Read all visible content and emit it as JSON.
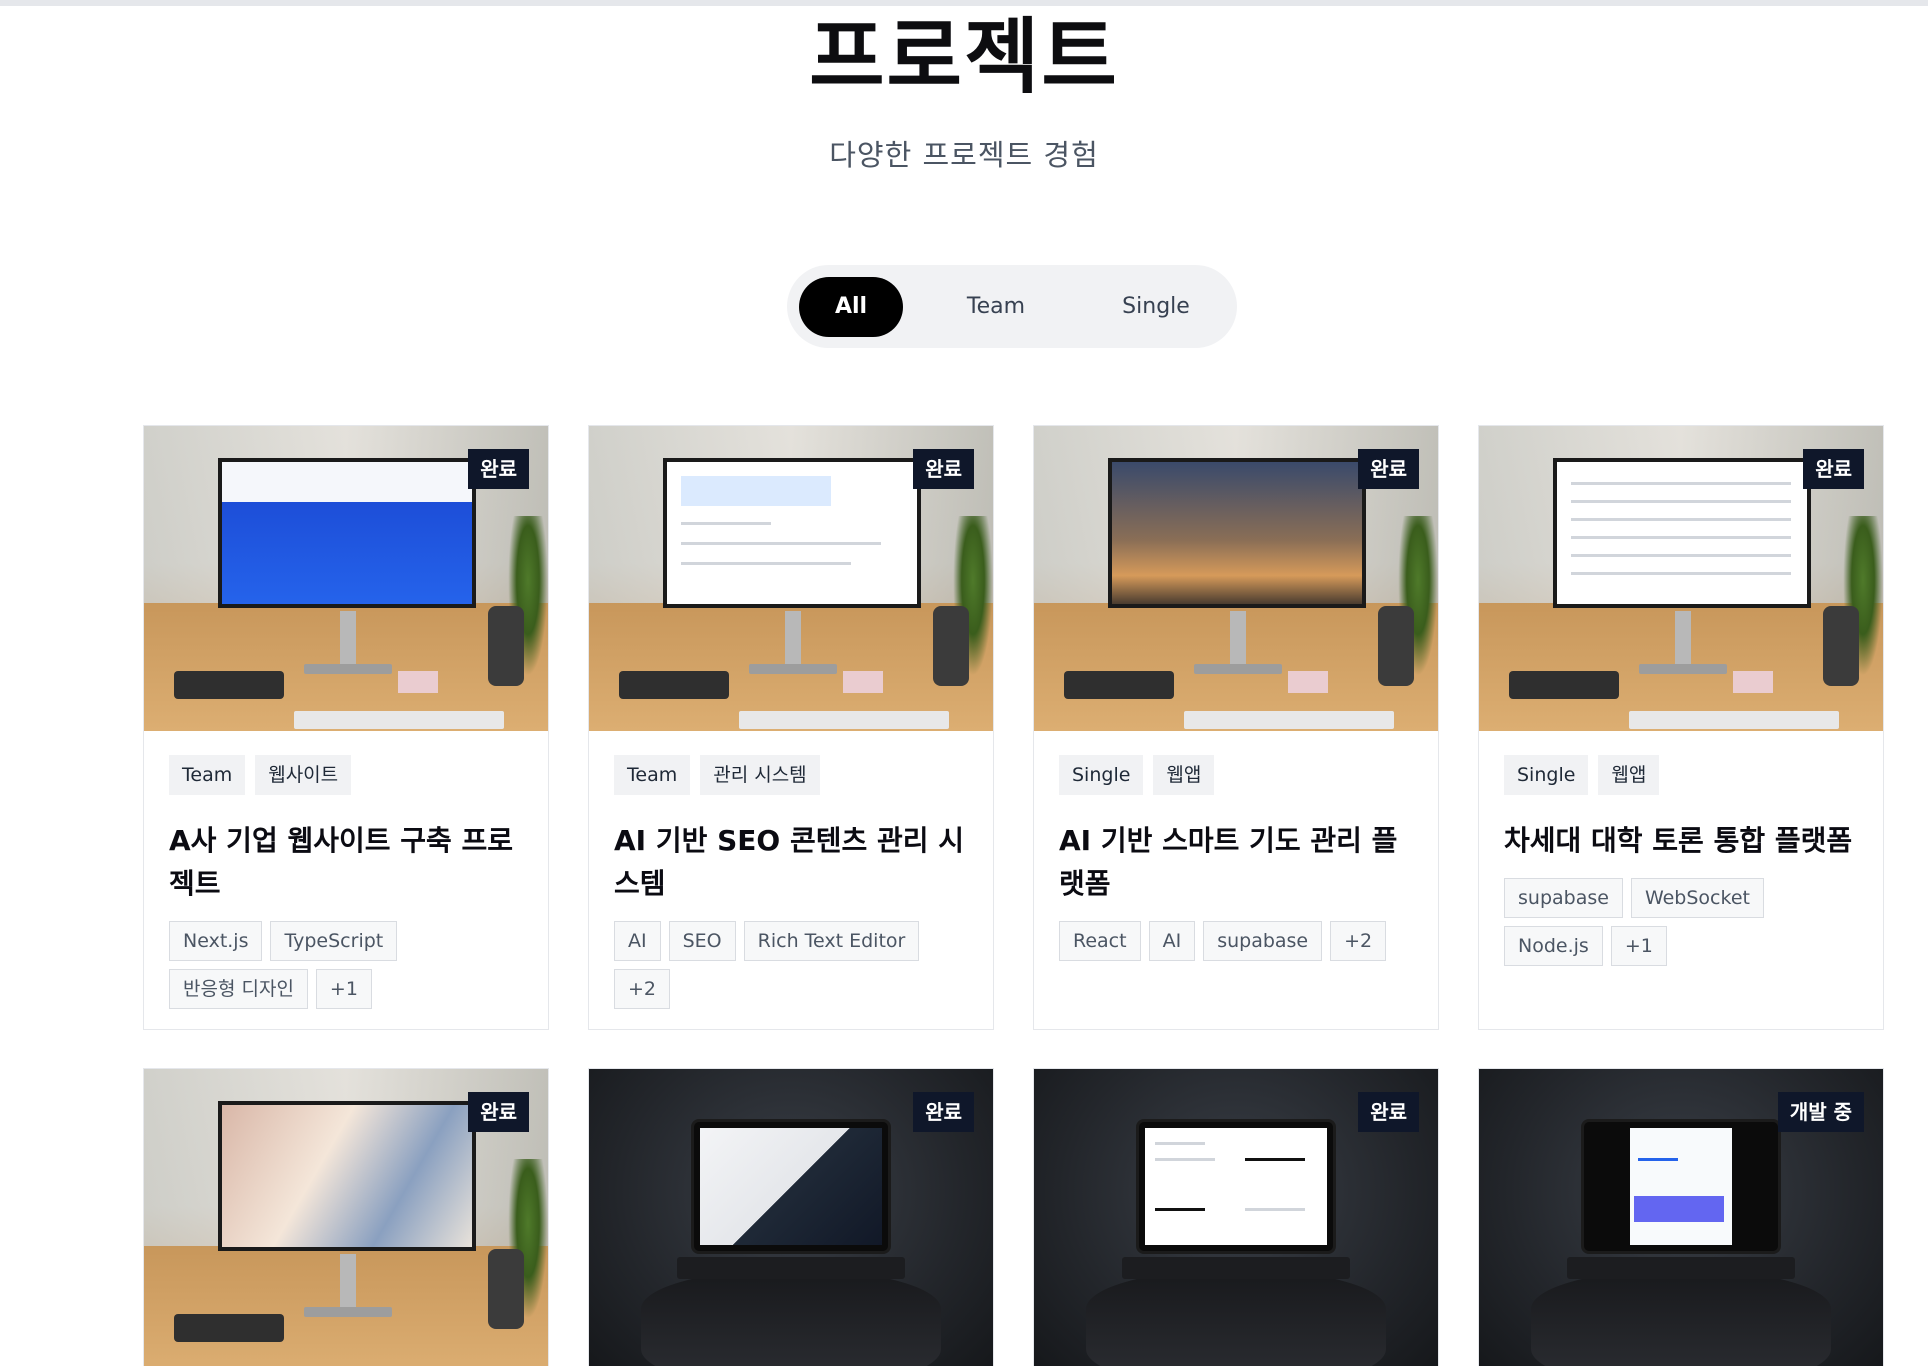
{
  "page": {
    "title": "프로젝트",
    "subtitle": "다양한 프로젝트 경험"
  },
  "filters": {
    "all": "All",
    "team": "Team",
    "single": "Single",
    "active": "All"
  },
  "projects": [
    {
      "status": "완료",
      "type": "Team",
      "category": "웹사이트",
      "title": "A사 기업 웹사이트 구축 프로젝트",
      "tech": [
        "Next.js",
        "TypeScript",
        "반응형 디자인",
        "+1"
      ],
      "thumb": "desk-blue"
    },
    {
      "status": "완료",
      "type": "Team",
      "category": "관리 시스템",
      "title": "AI 기반 SEO 콘텐츠 관리 시스템",
      "tech": [
        "AI",
        "SEO",
        "Rich Text Editor",
        "+2"
      ],
      "thumb": "desk-white"
    },
    {
      "status": "완료",
      "type": "Single",
      "category": "웹앱",
      "title": "AI 기반 스마트 기도 관리 플랫폼",
      "tech": [
        "React",
        "AI",
        "supabase",
        "+2"
      ],
      "thumb": "desk-sky"
    },
    {
      "status": "완료",
      "type": "Single",
      "category": "웹앱",
      "title": "차세대 대학 토론 통합 플랫폼",
      "tech": [
        "supabase",
        "WebSocket",
        "Node.js",
        "+1"
      ],
      "thumb": "desk-form"
    },
    {
      "status": "완료",
      "thumb": "desk-photo"
    },
    {
      "status": "완료",
      "thumb": "laptop-design"
    },
    {
      "status": "완료",
      "thumb": "laptop-doc"
    },
    {
      "status": "개발 중",
      "thumb": "laptop-app"
    }
  ]
}
